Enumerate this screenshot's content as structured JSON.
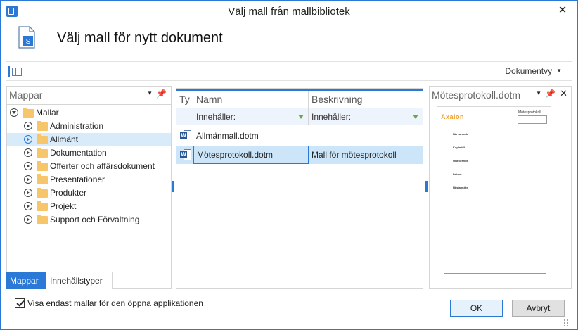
{
  "window": {
    "title": "Välj mall från mallbibliotek",
    "close_glyph": "✕"
  },
  "header": {
    "heading": "Välj mall för nytt dokument"
  },
  "toolbar": {
    "view_label": "Dokumentvy"
  },
  "left_pane": {
    "title": "Mappar",
    "tree": {
      "root": "Mallar",
      "items": [
        {
          "label": "Administration",
          "selected": false
        },
        {
          "label": "Allmänt",
          "selected": true
        },
        {
          "label": "Dokumentation",
          "selected": false
        },
        {
          "label": "Offerter och affärsdokument",
          "selected": false
        },
        {
          "label": "Presentationer",
          "selected": false
        },
        {
          "label": "Produkter",
          "selected": false
        },
        {
          "label": "Projekt",
          "selected": false
        },
        {
          "label": "Support och Förvaltning",
          "selected": false
        }
      ]
    },
    "tabs": [
      "Mappar",
      "Innehållstyper"
    ]
  },
  "grid": {
    "columns": [
      "Ty",
      "Namn",
      "Beskrivning"
    ],
    "filter": {
      "name": "Innehåller:",
      "description": "Innehåller:"
    },
    "rows": [
      {
        "name": "Allmänmall.dotm",
        "description": "",
        "selected": false
      },
      {
        "name": "Mötesprotokoll.dotm",
        "description": "Mall för mötesprotokoll",
        "selected": true
      }
    ]
  },
  "preview": {
    "title": "Mötesprotokoll.dotm",
    "page": {
      "logo": "Axalon",
      "doc_title": "Mötesprotokoll",
      "fields": [
        "Närvarande",
        "Kopia till",
        "Ordförande",
        "Datum",
        "Nästa möte"
      ]
    }
  },
  "bottom": {
    "checkbox_label": "Visa endast mallar för den öppna applikationen",
    "checkbox_checked": true,
    "ok_label": "OK",
    "cancel_label": "Avbryt"
  },
  "colors": {
    "accent": "#2b79d6",
    "folder": "#f8c66a",
    "selection": "#cde5f9"
  }
}
